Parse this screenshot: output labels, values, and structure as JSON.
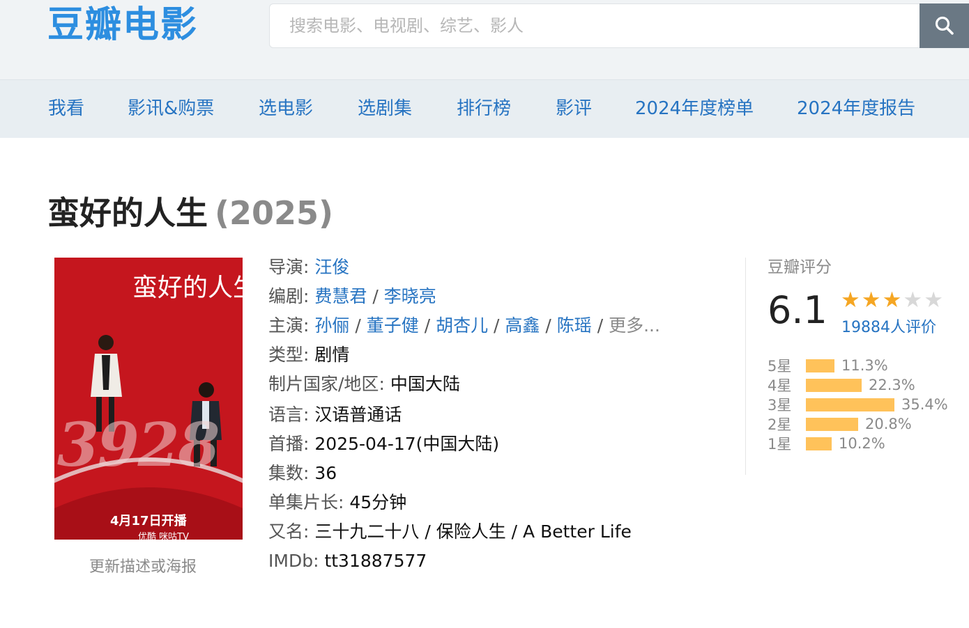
{
  "header": {
    "logo": "豆瓣电影",
    "search_placeholder": "搜索电影、电视剧、综艺、影人"
  },
  "nav": {
    "items": [
      "我看",
      "影讯&购票",
      "选电影",
      "选剧集",
      "排行榜",
      "影评",
      "2024年度榜单",
      "2024年度报告"
    ]
  },
  "subject": {
    "title": "蛮好的人生",
    "year": "(2025)",
    "poster": {
      "title": "蛮好的人生",
      "big_number": "3928",
      "release": "4月17日开播",
      "platforms": "优酷  咪咕TV"
    },
    "poster_caption": "更新描述或海报"
  },
  "info": {
    "director_label": "导演",
    "director": "汪俊",
    "writer_label": "编剧",
    "writers": [
      "费慧君",
      "李晓亮"
    ],
    "cast_label": "主演",
    "cast": [
      "孙俪",
      "董子健",
      "胡杏儿",
      "高鑫",
      "陈瑶"
    ],
    "cast_more": "更多...",
    "genre_label": "类型",
    "genre": "剧情",
    "country_label": "制片国家/地区",
    "country": "中国大陆",
    "language_label": "语言",
    "language": "汉语普通话",
    "premiere_label": "首播",
    "premiere": "2025-04-17(中国大陆)",
    "episodes_label": "集数",
    "episodes": "36",
    "runtime_label": "单集片长",
    "runtime": "45分钟",
    "aka_label": "又名",
    "aka": "三十九二十八 / 保险人生 / A Better Life",
    "imdb_label": "IMDb",
    "imdb": "tt31887577"
  },
  "rating": {
    "label": "豆瓣评分",
    "score": "6.1",
    "stars_filled": 3,
    "stars_total": 5,
    "count_text": "19884人评价",
    "distribution": [
      {
        "label": "5星",
        "percent": 11.3,
        "text": "11.3%"
      },
      {
        "label": "4星",
        "percent": 22.3,
        "text": "22.3%"
      },
      {
        "label": "3星",
        "percent": 35.4,
        "text": "35.4%"
      },
      {
        "label": "2星",
        "percent": 20.8,
        "text": "20.8%"
      },
      {
        "label": "1星",
        "percent": 10.2,
        "text": "10.2%"
      }
    ],
    "bar_color": "#ffc25a"
  },
  "colors": {
    "link": "#2774c2",
    "logo": "#2d8ee0",
    "poster_bg": "#c5161e",
    "star": "#f5a623"
  }
}
